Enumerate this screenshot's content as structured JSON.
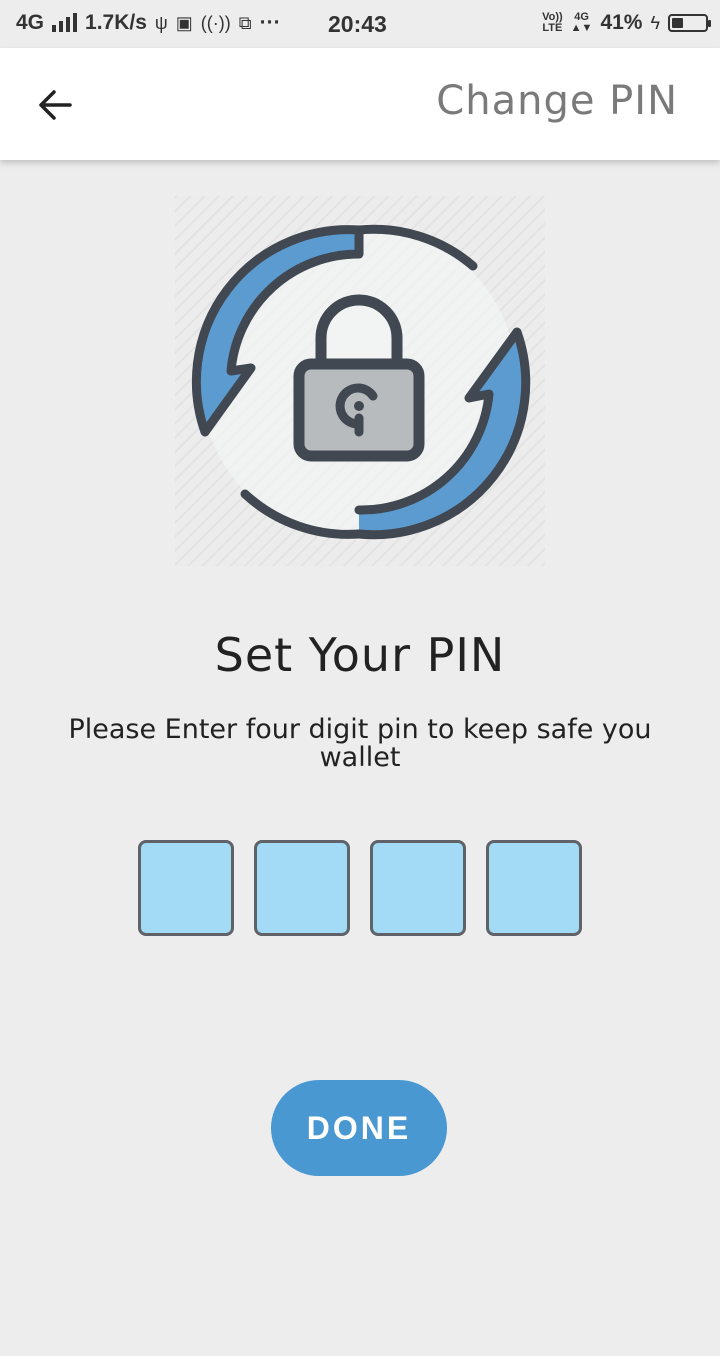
{
  "status_bar": {
    "network": "4G",
    "speed": "1.7K/s",
    "dots": "···",
    "time": "20:43",
    "volte": "Vo))",
    "lte": "LTE",
    "network_right": "4G",
    "battery": "41%",
    "battery_level": 0.41
  },
  "app_bar": {
    "back_icon": "arrow-left-icon",
    "title": "Change PIN"
  },
  "illustration": {
    "icon": "lock-refresh-icon",
    "accent_color": "#5b9bd0",
    "outline_color": "#414851"
  },
  "main": {
    "heading": "Set Your PIN",
    "subtitle_line1": "Please Enter four digit pin to keep safe you",
    "subtitle_line2": "wallet"
  },
  "pin": {
    "digits": [
      "",
      "",
      "",
      ""
    ],
    "box_color": "#a3daf5"
  },
  "done_button": {
    "label": "DONE",
    "color": "#4a98d2"
  }
}
